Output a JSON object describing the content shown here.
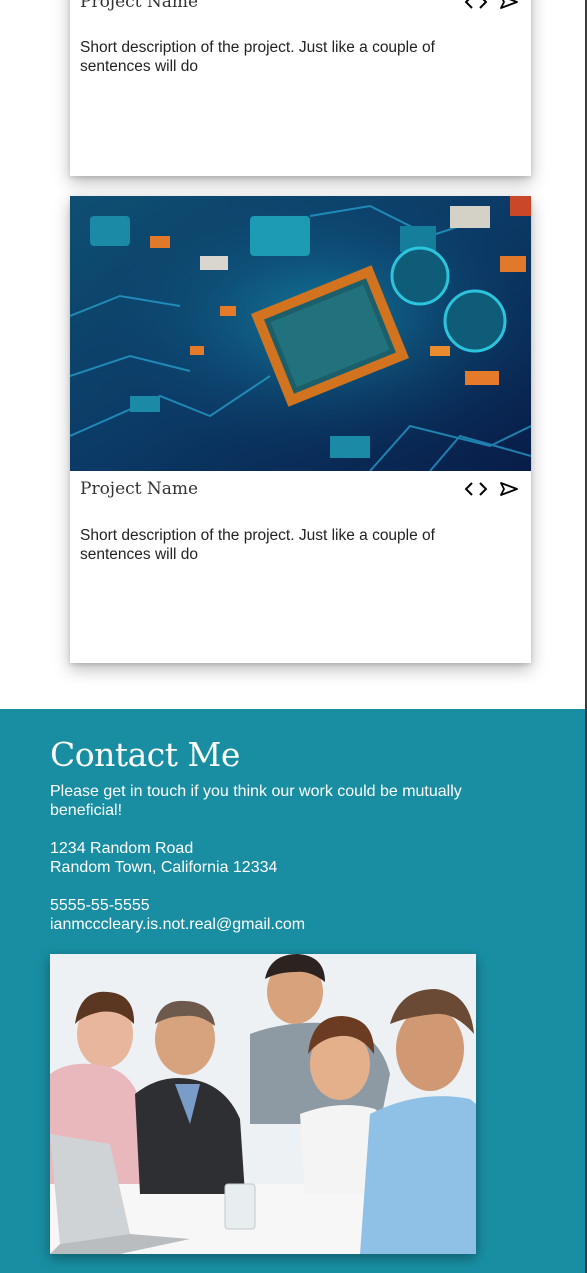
{
  "projects": [
    {
      "title": "Project Name",
      "description": "Short description of the project. Just like a couple of sentences will do"
    },
    {
      "title": "Project Name",
      "description": "Short description of the project. Just like a couple of sentences will do"
    }
  ],
  "contact": {
    "heading": "Contact Me",
    "intro": "Please get in touch if you think our work could be mutually beneficial!",
    "address_line1": "1234 Random Road",
    "address_line2": "Random Town, California 12334",
    "phone": "5555-55-5555",
    "email": "ianmcccleary.is.not.real@gmail.com"
  },
  "colors": {
    "contact_bg": "#198ea3",
    "card_bg": "#ffffff"
  }
}
